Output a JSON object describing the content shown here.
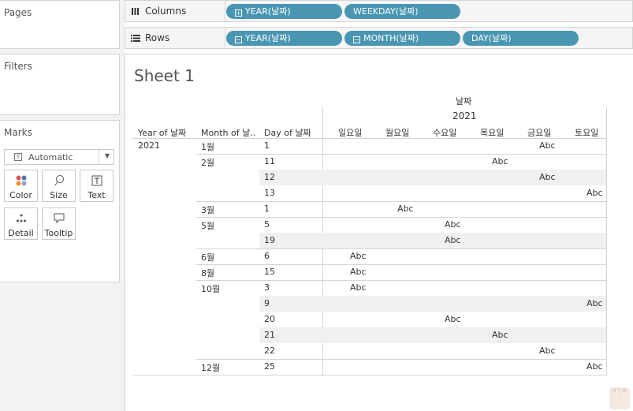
{
  "pages": {
    "title": "Pages"
  },
  "filters": {
    "title": "Filters"
  },
  "marks": {
    "title": "Marks",
    "mark_type": "Automatic",
    "buttons": [
      {
        "label": "Color",
        "icon": "color-dots-icon"
      },
      {
        "label": "Size",
        "icon": "size-lasso-icon"
      },
      {
        "label": "Text",
        "icon": "text-box-icon"
      },
      {
        "label": "Detail",
        "icon": "detail-dots-icon"
      },
      {
        "label": "Tooltip",
        "icon": "tooltip-bubble-icon"
      }
    ]
  },
  "shelves": {
    "columns": {
      "label": "Columns",
      "pills": [
        {
          "symbol": "+",
          "label": "YEAR(날짜)"
        },
        {
          "symbol": "",
          "label": "WEEKDAY(날짜)"
        }
      ]
    },
    "rows": {
      "label": "Rows",
      "pills": [
        {
          "symbol": "−",
          "label": "YEAR(날짜)"
        },
        {
          "symbol": "−",
          "label": "MONTH(날짜)"
        },
        {
          "symbol": "",
          "label": "DAY(날짜)"
        }
      ]
    }
  },
  "sheet": {
    "title": "Sheet 1",
    "field_header": "날짜",
    "year_header": "2021",
    "row_headers": [
      "Year of 날짜",
      "Month of 날..",
      "Day of 날짜"
    ],
    "weekdays": [
      "일요일",
      "월요일",
      "수요일",
      "목요일",
      "금요일",
      "토요일"
    ],
    "mark_text": "Abc",
    "year_value": "2021",
    "months": [
      {
        "label": "1월",
        "days": [
          {
            "day": "1",
            "weekday": 4
          }
        ]
      },
      {
        "label": "2월",
        "days": [
          {
            "day": "11",
            "weekday": 3
          },
          {
            "day": "12",
            "weekday": 4
          },
          {
            "day": "13",
            "weekday": 5
          }
        ]
      },
      {
        "label": "3월",
        "days": [
          {
            "day": "1",
            "weekday": 1
          }
        ]
      },
      {
        "label": "5월",
        "days": [
          {
            "day": "5",
            "weekday": 2
          },
          {
            "day": "19",
            "weekday": 2
          }
        ]
      },
      {
        "label": "6월",
        "days": [
          {
            "day": "6",
            "weekday": 0
          }
        ]
      },
      {
        "label": "8월",
        "days": [
          {
            "day": "15",
            "weekday": 0
          }
        ]
      },
      {
        "label": "10월",
        "days": [
          {
            "day": "3",
            "weekday": 0
          },
          {
            "day": "9",
            "weekday": 5
          },
          {
            "day": "20",
            "weekday": 2
          },
          {
            "day": "21",
            "weekday": 3
          },
          {
            "day": "22",
            "weekday": 4
          }
        ]
      },
      {
        "label": "12월",
        "days": [
          {
            "day": "25",
            "weekday": 5
          }
        ]
      }
    ]
  },
  "colors": {
    "pill": "#4996b2",
    "band": "#f0f0f0",
    "border": "#d4d4d4",
    "panel_bg": "#f2f2f2"
  }
}
